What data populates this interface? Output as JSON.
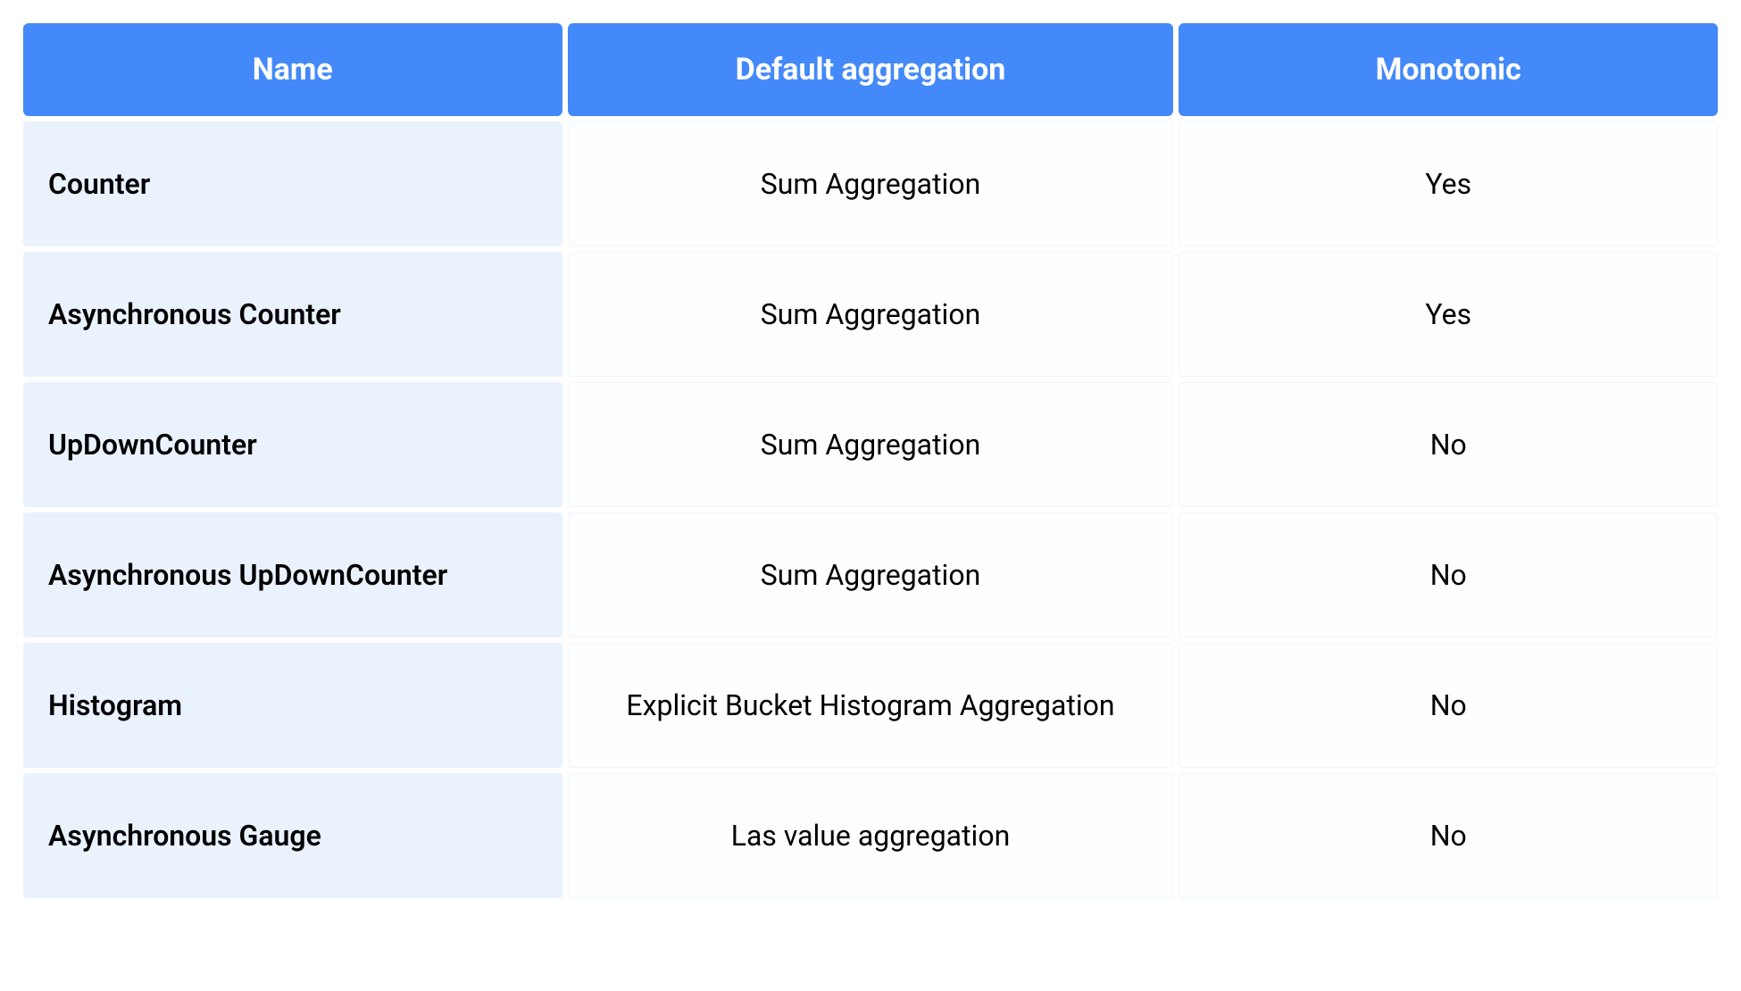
{
  "table": {
    "headers": {
      "name": "Name",
      "default_aggregation": "Default aggregation",
      "monotonic": "Monotonic"
    },
    "rows": [
      {
        "name": "Counter",
        "default_aggregation": "Sum Aggregation",
        "monotonic": "Yes"
      },
      {
        "name": "Asynchronous Counter",
        "default_aggregation": "Sum Aggregation",
        "monotonic": "Yes"
      },
      {
        "name": "UpDownCounter",
        "default_aggregation": "Sum Aggregation",
        "monotonic": "No"
      },
      {
        "name": "Asynchronous UpDownCounter",
        "default_aggregation": "Sum Aggregation",
        "monotonic": "No"
      },
      {
        "name": "Histogram",
        "default_aggregation": "Explicit Bucket Histogram Aggregation",
        "monotonic": "No"
      },
      {
        "name": "Asynchronous Gauge",
        "default_aggregation": "Las value aggregation",
        "monotonic": "No"
      }
    ]
  }
}
